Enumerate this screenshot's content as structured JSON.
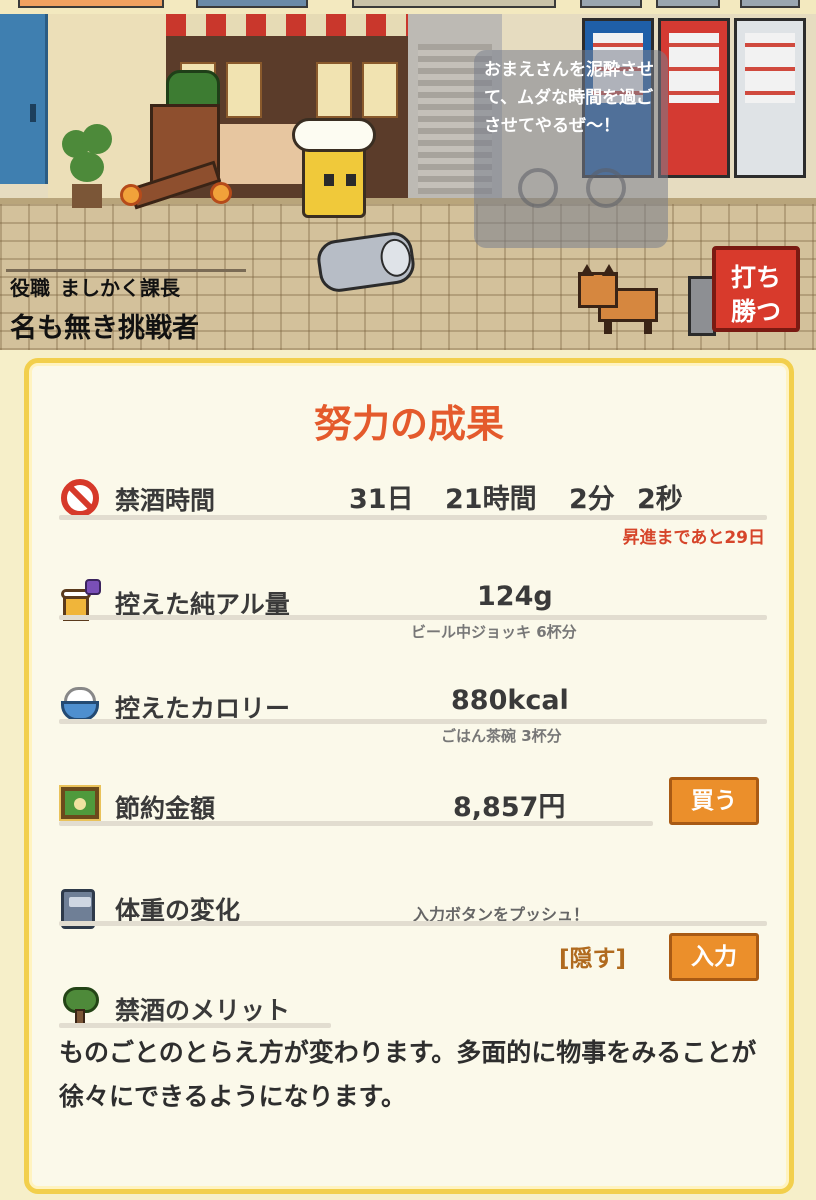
{
  "scene": {
    "speech_text": "おまえさんを泥酔させて、ムダな時間を過ごさせてやるぜ～！",
    "role_label": "役職",
    "role_value": "ましかく課長",
    "player_name": "名も無き挑戦者",
    "win_button": {
      "line1": "打ち",
      "line2": "勝つ"
    }
  },
  "panel": {
    "title": "努力の成果",
    "abstinence": {
      "icon": "no-drinking-icon",
      "label": "禁酒時間",
      "days": "31日",
      "hours": "21時間",
      "minutes": "2分",
      "seconds": "2秒",
      "promotion_note": "昇進まであと29日"
    },
    "alcohol": {
      "icon": "beer-mug-icon",
      "label": "控えた純アル量",
      "value": "124g",
      "equivalent": "ビール中ジョッキ 6杯分"
    },
    "calories": {
      "icon": "rice-bowl-icon",
      "label": "控えたカロリー",
      "value": "880kcal",
      "equivalent": "ごはん茶碗 3杯分"
    },
    "savings": {
      "icon": "money-bill-icon",
      "label": "節約金額",
      "value": "8,857円",
      "buy_button": "買う"
    },
    "weight": {
      "icon": "scale-icon",
      "label": "体重の変化",
      "hint": "入力ボタンをプッシュ！",
      "hide_link": "[隠す]",
      "input_button": "入力"
    },
    "merit": {
      "icon": "tree-icon",
      "label": "禁酒のメリット",
      "text": "ものごとのとらえ方が変わります。多面的に物事をみることが徐々にできるようになります。"
    }
  },
  "colors": {
    "accent_title": "#e45a2c",
    "button_orange": "#eb8f2b",
    "panel_border": "#f2cf4c",
    "win_button_red": "#d83a2c",
    "promotion_note": "#d6452a"
  }
}
